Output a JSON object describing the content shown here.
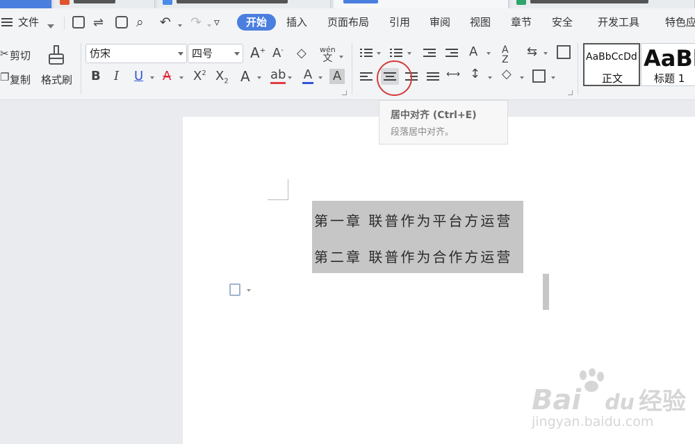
{
  "menu": {
    "file": "文件",
    "tabs": [
      {
        "label": "开始",
        "active": true
      },
      {
        "label": "插入"
      },
      {
        "label": "页面布局"
      },
      {
        "label": "引用"
      },
      {
        "label": "审阅"
      },
      {
        "label": "视图"
      },
      {
        "label": "章节"
      },
      {
        "label": "安全"
      },
      {
        "label": "开发工具"
      },
      {
        "label": "特色应"
      }
    ]
  },
  "ribbon": {
    "cut": "剪切",
    "copy": "复制",
    "format_painter": "格式刷",
    "font_name": "仿宋",
    "font_size": "四号",
    "phonetic": "wén",
    "styles": [
      {
        "preview": "AaBbCcDd",
        "name": "正文"
      },
      {
        "preview": "AaBb",
        "name": "标题 1"
      }
    ]
  },
  "tooltip": {
    "title": "居中对齐 (Ctrl+E)",
    "desc": "段落居中对齐。"
  },
  "document": {
    "lines": [
      "第一章 联普作为平台方运营",
      "第二章 联普作为合作方运营"
    ]
  },
  "watermark": {
    "brand": "Bai",
    "brand2": "du",
    "cn": "经验",
    "url": "jingyan.baidu.com"
  },
  "colors": {
    "accent": "#4a7fe0",
    "highlight_circle": "#d43a3a",
    "selection": "#c6c6c6",
    "font_color_bar": "#2f56d8",
    "highlight_bar": "#e23d3d"
  }
}
